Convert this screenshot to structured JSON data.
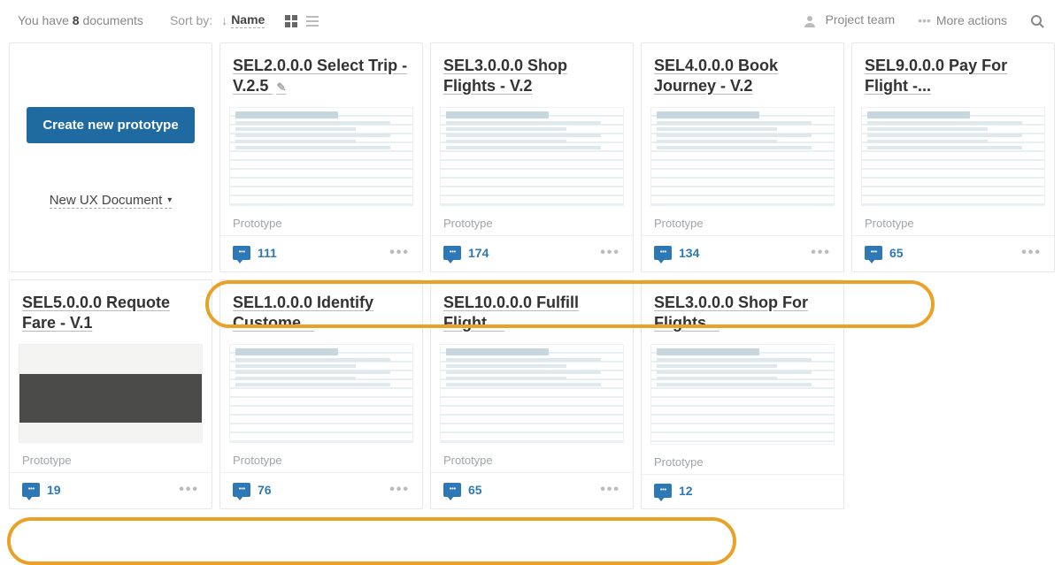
{
  "topbar": {
    "doc_count_prefix": "You have ",
    "doc_count": "8",
    "doc_count_suffix": " documents",
    "sortby_label": "Sort by:",
    "sort_arrow": "↓",
    "sort_field": "Name",
    "project_team": "Project team",
    "more_actions": "More actions"
  },
  "create": {
    "button": "Create new prototype",
    "new_ux": "New UX Document"
  },
  "type_label": "Prototype",
  "cards_row1": [
    {
      "title": "SEL2.0.0.0 Select Trip - V.2.5",
      "editing": true,
      "comments": "111",
      "has_menu": true,
      "thumb": "doc"
    },
    {
      "title": "SEL3.0.0.0 Shop Flights - V.2",
      "comments": "174",
      "has_menu": true,
      "thumb": "doc"
    },
    {
      "title": "SEL4.0.0.0 Book Journey - V.2",
      "comments": "134",
      "has_menu": true,
      "thumb": "doc"
    },
    {
      "title": "SEL9.0.0.0 Pay For Flight -...",
      "comments": "65",
      "has_menu": true,
      "thumb": "doc"
    }
  ],
  "cards_row2": [
    {
      "title": "SEL5.0.0.0 Requote Fare - V.1",
      "comments": "19",
      "has_menu": true,
      "thumb": "dark"
    },
    {
      "title": "SEL1.0.0.0 Identify Custome...",
      "comments": "76",
      "has_menu": true,
      "thumb": "doc"
    },
    {
      "title": "SEL10.0.0.0 Fulfill Flight ...",
      "comments": "65",
      "has_menu": true,
      "thumb": "doc"
    },
    {
      "title": "SEL3.0.0.0 Shop For Flights...",
      "comments": "12",
      "has_menu": false,
      "thumb": "doc"
    }
  ]
}
